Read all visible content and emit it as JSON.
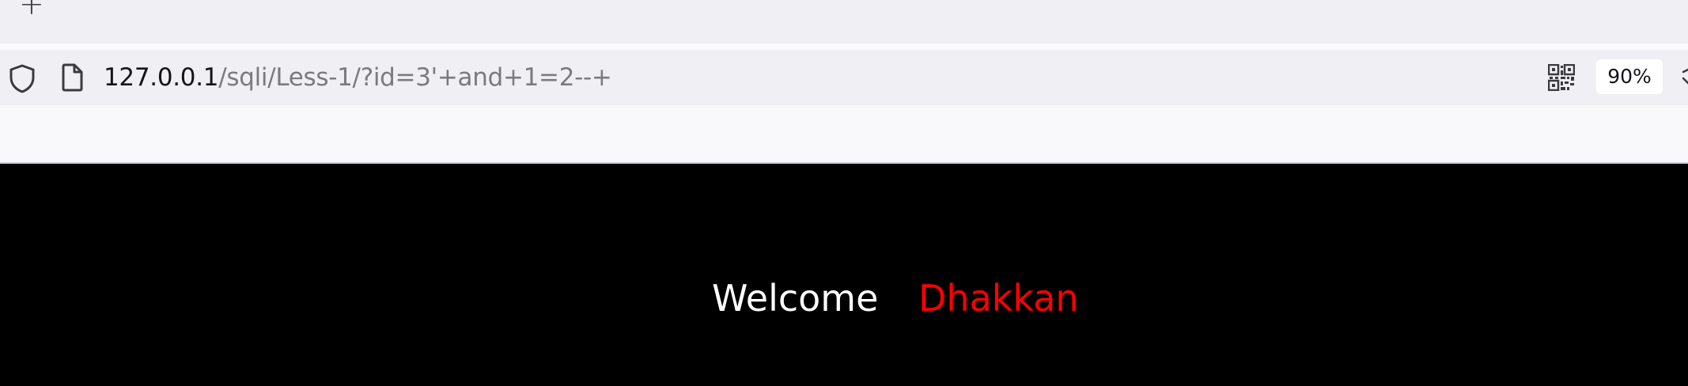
{
  "tabstrip": {
    "new_tab_icon": "plus-icon",
    "new_tab_glyph": "+"
  },
  "navbar": {
    "security_icon": "shield-icon",
    "page_icon": "page-icon",
    "url_host": "127.0.0.1",
    "url_path": "/sqli/Less-1/?id=3'+and+1=2--+",
    "qr_icon": "qr-code-icon",
    "zoom_level": "90%"
  },
  "page": {
    "welcome_text": "Welcome",
    "username_text": "Dhakkan",
    "background_color": "#000000",
    "welcome_color": "#ffffff",
    "username_color": "#ff0000"
  }
}
